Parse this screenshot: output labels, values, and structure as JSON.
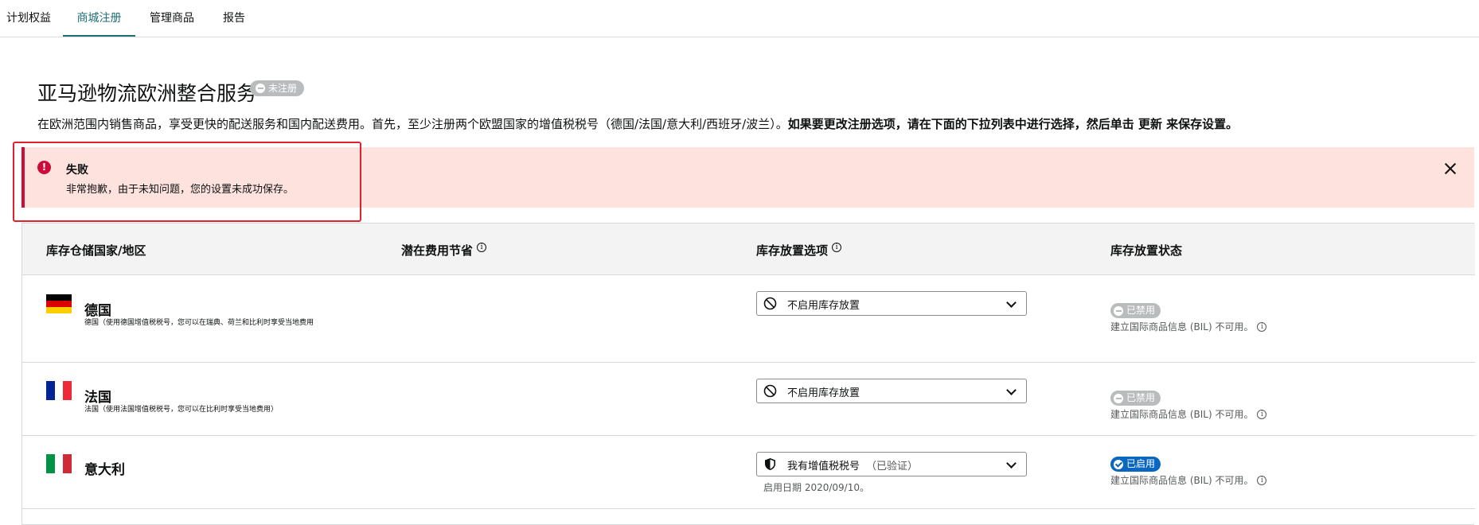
{
  "tabs": [
    {
      "label": "计划权益",
      "active": false
    },
    {
      "label": "商城注册",
      "active": true
    },
    {
      "label": "管理商品",
      "active": false
    },
    {
      "label": "报告",
      "active": false
    }
  ],
  "header": {
    "title": "亚马逊物流欧洲整合服务",
    "status": "未注册",
    "description_normal": "在欧洲范围内销售商品，享受更快的配送服务和国内配送费用。首先，至少注册两个欧盟国家的增值税税号（德国/法国/意大利/西班牙/波兰）。",
    "description_bold": "如果要更改注册选项，请在下面的下拉列表中进行选择，然后单击 更新 来保存设置。"
  },
  "alert": {
    "title": "失败",
    "message": "非常抱歉，由于未知问题，您的设置未成功保存。",
    "icon": "!",
    "color": "#cc0c39"
  },
  "table": {
    "headers": [
      "库存仓储国家/地区",
      "潜在费用节省",
      "库存放置选项",
      "库存放置状态"
    ],
    "rows": [
      {
        "country": "德国",
        "note": "德国（使用德国增值税税号，您可以在瑞典、荷兰和比利时享受当地费用",
        "flag": [
          "#000000",
          "#dd0000",
          "#ffce00"
        ],
        "option": "不启用库存放置",
        "option_sub": "",
        "enable_date": "",
        "status": "已禁用",
        "status_type": "disabled",
        "bil": "建立国际商品信息 (BIL) 不可用。"
      },
      {
        "country": "法国",
        "note": "法国（使用法国增值税税号，您可以在比利时享受当地费用）",
        "flag": [
          "#002395",
          "#ffffff",
          "#ed2939"
        ],
        "option": "不启用库存放置",
        "option_sub": "",
        "enable_date": "",
        "status": "已禁用",
        "status_type": "disabled",
        "bil": "建立国际商品信息 (BIL) 不可用。"
      },
      {
        "country": "意大利",
        "note": "",
        "flag": [
          "#009246",
          "#ffffff",
          "#ce2b37"
        ],
        "option": "我有增值税税号",
        "option_sub": "（已验证）",
        "enable_date": "启用日期 2020/09/10。",
        "status": "已启用",
        "status_type": "enabled",
        "bil": "建立国际商品信息 (BIL) 不可用。"
      }
    ]
  }
}
